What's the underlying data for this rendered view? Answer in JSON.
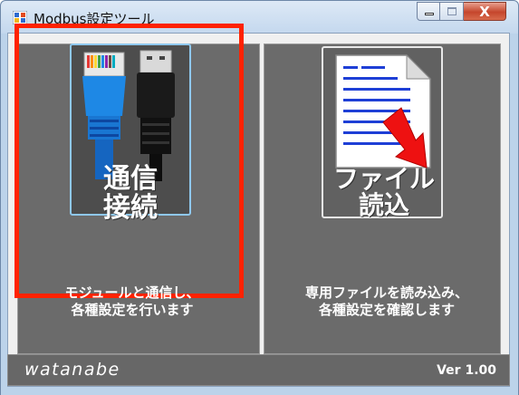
{
  "window": {
    "title": "Modbus設定ツール",
    "close_glyph": "X"
  },
  "left_panel": {
    "icon_caption_line1": "通信",
    "icon_caption_line2": "接続",
    "description_line1": "モジュールと通信し、",
    "description_line2": "各種設定を行います",
    "highlight_color": "#ff2200"
  },
  "right_panel": {
    "icon_caption_line1": "ファイル",
    "icon_caption_line2": "読込",
    "description_line1": "専用ファイルを読み込み、",
    "description_line2": "各種設定を確認します"
  },
  "footer": {
    "brand": "watanabe",
    "version": "Ver 1.00"
  },
  "icons": {
    "comm": "network-cable-usb-icon",
    "file": "document-arrow-icon"
  }
}
